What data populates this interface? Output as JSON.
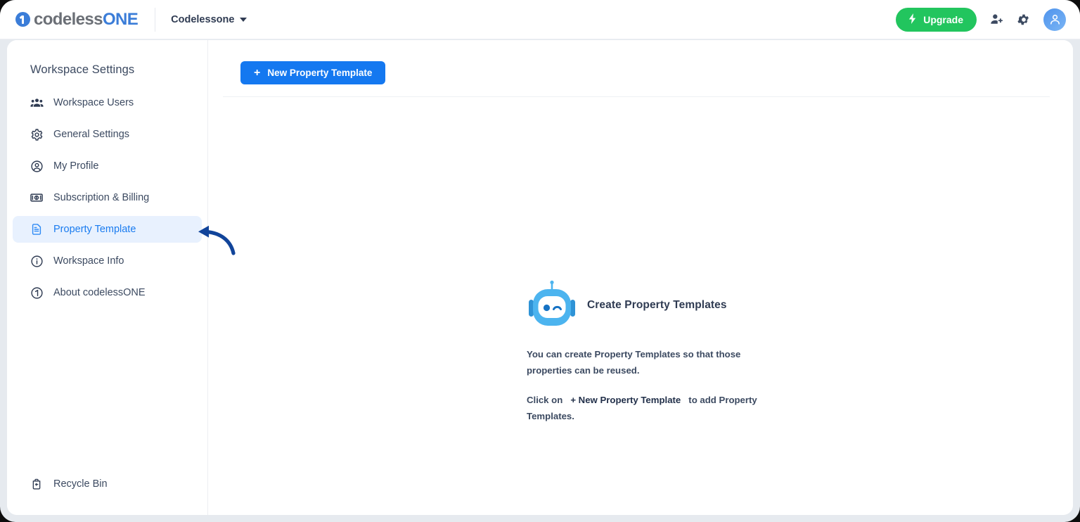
{
  "header": {
    "logo": {
      "part1": "codeless",
      "part2": "ONE",
      "icon": "codeless-one-logo-icon"
    },
    "workspace_name": "Codelessone",
    "upgrade_label": "Upgrade",
    "upgrade_icon": "lightning-bolt-icon",
    "upgrade_color": "#22c55e",
    "invite_icon": "add-user-icon",
    "settings_icon": "gear-icon",
    "avatar_icon": "user-avatar-icon"
  },
  "sidebar": {
    "title": "Workspace Settings",
    "items": [
      {
        "label": "Workspace Users",
        "icon": "users-group-icon",
        "active": false
      },
      {
        "label": "General Settings",
        "icon": "gear-icon",
        "active": false
      },
      {
        "label": "My Profile",
        "icon": "user-circle-icon",
        "active": false
      },
      {
        "label": "Subscription & Billing",
        "icon": "banknote-icon",
        "active": false
      },
      {
        "label": "Property Template",
        "icon": "document-icon",
        "active": true
      },
      {
        "label": "Workspace Info",
        "icon": "info-circle-icon",
        "active": false
      },
      {
        "label": "About codelessONE",
        "icon": "codeless-one-mark-icon",
        "active": false
      }
    ],
    "bottom_item": {
      "label": "Recycle Bin",
      "icon": "recycle-bin-icon"
    },
    "active_color": "#1a7cf0",
    "active_background": "#e8f1fe"
  },
  "main": {
    "new_template_button": {
      "label": "New Property Template",
      "plus": "+",
      "color": "#1478f0"
    },
    "empty_state": {
      "mascot_icon": "robot-mascot-icon",
      "title": "Create Property Templates",
      "body_line1": "You can create Property Templates so that those properties can be reused.",
      "body_line2_prefix": "Click on",
      "body_line2_strong": "+ New Property Template",
      "body_line2_suffix": "to add Property Templates."
    }
  },
  "annotation": {
    "arrow_icon": "curved-left-arrow-icon",
    "color": "#11449a"
  }
}
